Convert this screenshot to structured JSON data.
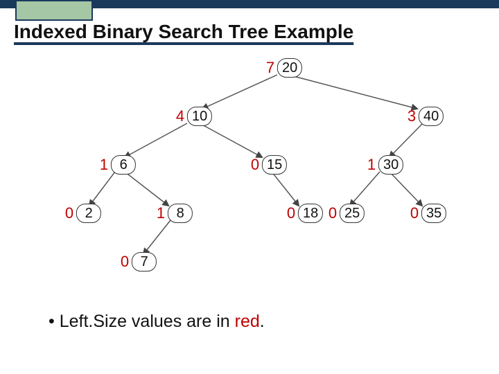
{
  "title": "Indexed Binary Search Tree Example",
  "footnote_prefix": "• Left.Size values are in ",
  "footnote_red": "red",
  "footnote_suffix": ".",
  "nodes": {
    "n20": {
      "left_size": "7",
      "value": "20"
    },
    "n10": {
      "left_size": "4",
      "value": "10"
    },
    "n40": {
      "left_size": "3",
      "value": "40"
    },
    "n6": {
      "left_size": "1",
      "value": "6"
    },
    "n15": {
      "left_size": "0",
      "value": "15"
    },
    "n30": {
      "left_size": "1",
      "value": "30"
    },
    "n2": {
      "left_size": "0",
      "value": "2"
    },
    "n8": {
      "left_size": "1",
      "value": "8"
    },
    "n18": {
      "left_size": "0",
      "value": "18"
    },
    "n25": {
      "left_size": "0",
      "value": "25"
    },
    "n35": {
      "left_size": "0",
      "value": "35"
    },
    "n7": {
      "left_size": "0",
      "value": "7"
    }
  },
  "chart_data": {
    "type": "tree",
    "title": "Indexed Binary Search Tree Example",
    "note": "Left.Size values are in red.",
    "nodes": [
      {
        "id": "20",
        "left_size": 7,
        "parent": null
      },
      {
        "id": "10",
        "left_size": 4,
        "parent": "20",
        "side": "left"
      },
      {
        "id": "40",
        "left_size": 3,
        "parent": "20",
        "side": "right"
      },
      {
        "id": "6",
        "left_size": 1,
        "parent": "10",
        "side": "left"
      },
      {
        "id": "15",
        "left_size": 0,
        "parent": "10",
        "side": "right"
      },
      {
        "id": "30",
        "left_size": 1,
        "parent": "40",
        "side": "left"
      },
      {
        "id": "2",
        "left_size": 0,
        "parent": "6",
        "side": "left"
      },
      {
        "id": "8",
        "left_size": 1,
        "parent": "6",
        "side": "right"
      },
      {
        "id": "18",
        "left_size": 0,
        "parent": "15",
        "side": "right"
      },
      {
        "id": "25",
        "left_size": 0,
        "parent": "30",
        "side": "left"
      },
      {
        "id": "35",
        "left_size": 0,
        "parent": "30",
        "side": "right"
      },
      {
        "id": "7",
        "left_size": 0,
        "parent": "8",
        "side": "left"
      }
    ]
  }
}
